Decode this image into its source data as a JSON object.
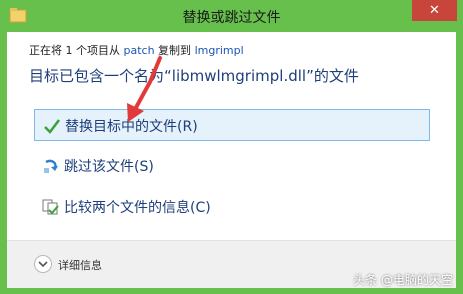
{
  "window": {
    "title": "替换或跳过文件",
    "close_label": "✕"
  },
  "info": {
    "prefix": "正在将 1 个项目从 ",
    "source": "patch",
    "middle": " 复制到 ",
    "destination": "lmgrimpl"
  },
  "heading": "目标已包含一个名为“libmwlmgrimpl.dll”的文件",
  "options": [
    {
      "label": "替换目标中的文件(R)",
      "icon": "check-icon"
    },
    {
      "label": "跳过该文件(S)",
      "icon": "skip-arrow-icon"
    },
    {
      "label": "比较两个文件的信息(C)",
      "icon": "compare-icon"
    }
  ],
  "footer": {
    "more_details": "详细信息"
  },
  "watermark": "头条 @电脑的天空",
  "colors": {
    "titlebar": "#66c04b",
    "close": "#c7453a",
    "heading": "#1e3f7a",
    "arrow": "#e23a3a"
  }
}
